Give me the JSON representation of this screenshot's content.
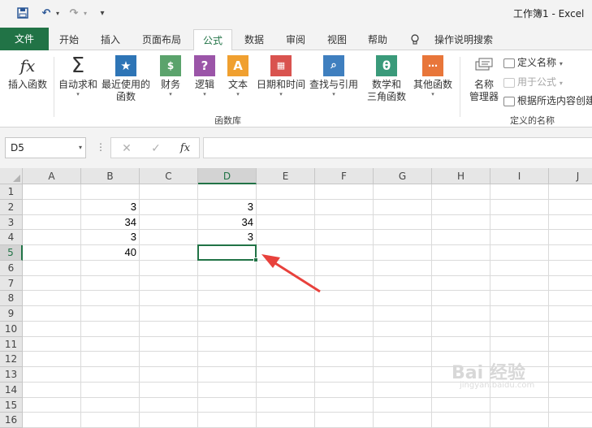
{
  "quick_access": {
    "save_icon": "save-icon",
    "undo_icon": "undo-icon",
    "redo_icon": "redo-icon",
    "customize_icon": "customize-qat-icon",
    "undo_glyph": "↶",
    "redo_glyph": "↷",
    "drop_glyph": "▾",
    "customize_glyph": "▾"
  },
  "title": "工作簿1 - Excel",
  "tabs": [
    "文件",
    "开始",
    "插入",
    "页面布局",
    "公式",
    "数据",
    "审阅",
    "视图",
    "帮助"
  ],
  "active_tab": "公式",
  "tell_me": "操作说明搜索",
  "ribbon": {
    "function_library": {
      "label": "函数库",
      "insert_function": "插入函数",
      "autosum": "自动求和",
      "recent_line1": "最近使用的",
      "recent_line2": "函数",
      "financial": "财务",
      "logical": "逻辑",
      "text": "文本",
      "datetime": "日期和时间",
      "lookup": "查找与引用",
      "math_line1": "数学和",
      "math_line2": "三角函数",
      "other": "其他函数"
    },
    "defined_names": {
      "label": "定义的名称",
      "name_manager_line1": "名称",
      "name_manager_line2": "管理器",
      "define_name": "定义名称",
      "use_in_formula": "用于公式",
      "create_from_selection": "根据所选内容创建"
    },
    "icon_glyphs": {
      "fx": "fx",
      "sigma": "Σ",
      "star": "★",
      "question": "?",
      "letter_a": "A",
      "theta": "θ",
      "caret": "▾"
    },
    "colors": {
      "financial": "#5ba36c",
      "logical": "#9b55a8",
      "text": "#f0a030",
      "datetime": "#d9534f",
      "lookup": "#3f7fbf",
      "math": "#3a9a7a",
      "other": "#e8763a",
      "recent": "#2e75b6"
    }
  },
  "formula_bar": {
    "name_box": "D5",
    "name_box_arrow": "▾",
    "dots": "⋮",
    "cancel": "✕",
    "enter": "✓",
    "fx": "fx",
    "formula": ""
  },
  "sheet": {
    "columns": [
      "A",
      "B",
      "C",
      "D",
      "E",
      "F",
      "G",
      "H",
      "I",
      "J"
    ],
    "rows": [
      "1",
      "2",
      "3",
      "4",
      "5",
      "6",
      "7",
      "8",
      "9",
      "10",
      "11",
      "12",
      "13",
      "14",
      "15",
      "16"
    ],
    "active_cell": "D5",
    "cells": {
      "B2": "3",
      "B3": "34",
      "B4": "3",
      "B5": "40",
      "D2": "3",
      "D3": "34",
      "D4": "3"
    }
  },
  "annotation_arrow_color": "#e8413c",
  "watermark": {
    "text": "Bai 经验",
    "sub": "jingyan.baidu.com"
  },
  "theme": {
    "excel_green": "#217346"
  }
}
